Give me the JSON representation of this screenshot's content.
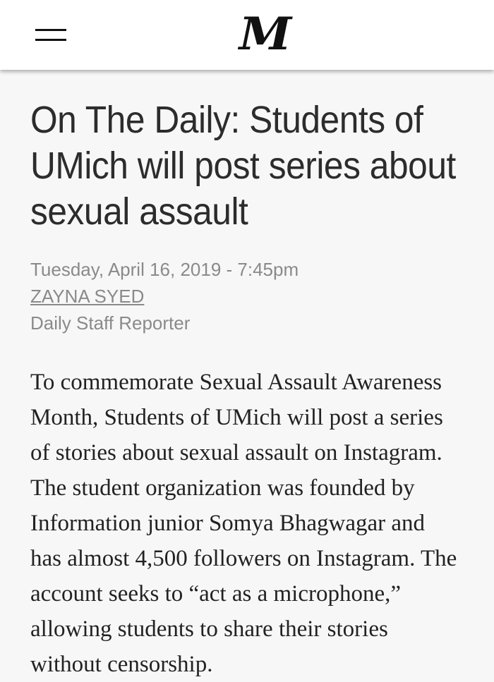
{
  "header": {
    "logo_text": "M",
    "menu_icon": "hamburger-menu-icon"
  },
  "article": {
    "headline": "On The Daily: Students of UMich will post series about sexual assault",
    "date": "Tuesday, April 16, 2019 - 7:45pm",
    "author": "ZAYNA SYED",
    "author_role": "Daily Staff Reporter",
    "body_lines": [
      "To commemorate Sexual Assault Awareness",
      "Month, Students of UMich will post a series",
      "of stories about sexual assault on Instagram.",
      "The student organization was founded by",
      "Information junior Somya Bhagwagar and",
      "has almost 4,500 followers on Instagram. The",
      "account seeks to “act as a microphone,”",
      "allowing students to share their stories",
      "without censorship."
    ]
  },
  "colors": {
    "page_background": "#f7f7f7",
    "header_background": "#ffffff",
    "headline_text": "#2c2c2c",
    "meta_text": "#8a8a8a",
    "body_text": "#222222"
  }
}
